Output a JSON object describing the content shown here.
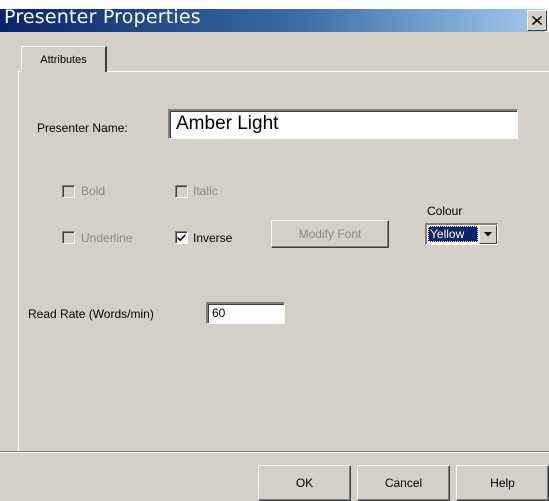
{
  "window": {
    "title": "Presenter Properties",
    "close_glyph": "✕"
  },
  "tabs": [
    {
      "label": "Attributes",
      "selected": true
    }
  ],
  "presenter_name": {
    "label": "Presenter Name:",
    "value": "Amber Light"
  },
  "font_options": {
    "bold": {
      "label": "Bold",
      "checked": false,
      "enabled": false
    },
    "italic": {
      "label": "Italic",
      "checked": false,
      "enabled": false
    },
    "underline": {
      "label": "Underline",
      "checked": false,
      "enabled": false
    },
    "inverse": {
      "label": "Inverse",
      "checked": true,
      "enabled": true
    },
    "modify_font_label": "Modify Font"
  },
  "colour": {
    "label": "Colour",
    "selected": "Yellow"
  },
  "read_rate": {
    "label": "Read Rate (Words/min)",
    "value": "60"
  },
  "buttons": {
    "ok": "OK",
    "cancel": "Cancel",
    "help": "Help"
  },
  "colors": {
    "title_gradient_start": "#0a246a",
    "title_gradient_end": "#a6caf0",
    "face": "#d4d0c8",
    "selection": "#0a246a"
  },
  "icons": {
    "close": "close-icon",
    "check": "checkmark-icon",
    "dropdown": "chevron-down-icon"
  }
}
